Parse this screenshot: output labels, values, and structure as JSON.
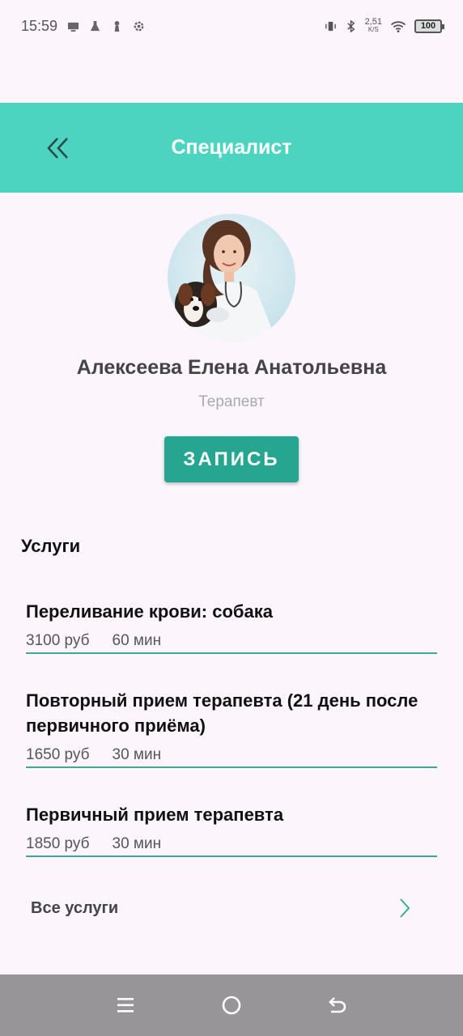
{
  "status_bar": {
    "time": "15:59",
    "net_speed_value": "2,51",
    "net_speed_unit": "K/S",
    "battery": "100"
  },
  "header": {
    "title": "Специалист"
  },
  "specialist": {
    "name": "Алексеева Елена Анатольевна",
    "role": "Терапевт",
    "book_label": "ЗАПИСЬ"
  },
  "services": {
    "title": "Услуги",
    "items": [
      {
        "name": "Переливание крови: собака",
        "price": "3100 руб",
        "duration": "60 мин"
      },
      {
        "name": "Повторный прием терапевта (21 день после первичного приёма)",
        "price": "1650 руб",
        "duration": "30 мин"
      },
      {
        "name": "Первичный прием терапевта",
        "price": "1850 руб",
        "duration": "30 мин"
      }
    ],
    "all_label": "Все услуги"
  },
  "colors": {
    "accent": "#4dd4c0",
    "button": "#26a590",
    "divider": "#3aa996"
  }
}
